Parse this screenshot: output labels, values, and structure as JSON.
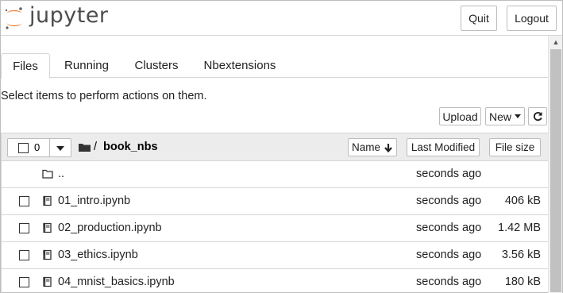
{
  "header": {
    "logo_text": "jupyter",
    "quit_label": "Quit",
    "logout_label": "Logout"
  },
  "tabs": [
    {
      "label": "Files"
    },
    {
      "label": "Running"
    },
    {
      "label": "Clusters"
    },
    {
      "label": "Nbextensions"
    }
  ],
  "hint": "Select items to perform actions on them.",
  "toolbar": {
    "upload_label": "Upload",
    "new_label": "New",
    "refresh_icon": "refresh-icon"
  },
  "list_header": {
    "selected_count": "0",
    "path_separator": "/",
    "folder_name": "book_nbs",
    "sort_name_label": "Name",
    "sort_modified_label": "Last Modified",
    "sort_size_label": "File size"
  },
  "files": [
    {
      "name": "..",
      "modified": "seconds ago",
      "size": "",
      "icon": "folder-icon"
    },
    {
      "name": "01_intro.ipynb",
      "modified": "seconds ago",
      "size": "406 kB",
      "icon": "notebook-icon"
    },
    {
      "name": "02_production.ipynb",
      "modified": "seconds ago",
      "size": "1.42 MB",
      "icon": "notebook-icon"
    },
    {
      "name": "03_ethics.ipynb",
      "modified": "seconds ago",
      "size": "3.56 kB",
      "icon": "notebook-icon"
    },
    {
      "name": "04_mnist_basics.ipynb",
      "modified": "seconds ago",
      "size": "180 kB",
      "icon": "notebook-icon"
    }
  ],
  "colors": {
    "logo_orange": "#f37726",
    "logo_gray": "#616161",
    "border": "#bdbdbd",
    "list_header_bg": "#ececec"
  }
}
